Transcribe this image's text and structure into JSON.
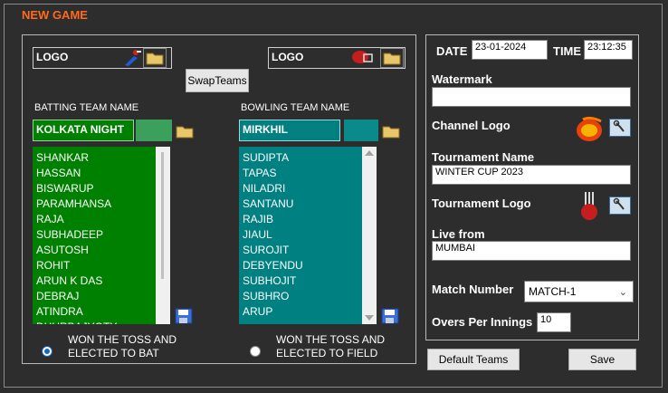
{
  "window": {
    "title": "NEW GAME"
  },
  "batting": {
    "logo_label": "LOGO",
    "team_label": "BATTING TEAM NAME",
    "team_name": "KOLKATA NIGHT",
    "players": [
      "SHANKAR",
      "HASSAN",
      "BISWARUP",
      "PARAMHANSA",
      "RAJA",
      "SUBHADEEP",
      "ASUTOSH",
      "ROHIT",
      "ARUN K DAS",
      "DEBRAJ",
      "ATINDRA",
      "DHURBAJYOTY"
    ],
    "toss_label_1": "WON THE TOSS AND",
    "toss_label_2": "ELECTED TO BAT",
    "color": "#008000"
  },
  "bowling": {
    "logo_label": "LOGO",
    "team_label": "BOWLING TEAM NAME",
    "team_name": "MIRKHIL",
    "players": [
      "SUDIPTA",
      "TAPAS",
      "NILADRI",
      "SANTANU",
      "RAJIB",
      "JIAUL",
      "SUROJIT",
      "DEBYENDU",
      "SUBHOJIT",
      "SUBHRO",
      "ARUP"
    ],
    "toss_label_1": "WON THE TOSS AND",
    "toss_label_2": "ELECTED TO FIELD",
    "color": "#008080"
  },
  "swap_button": "SwapTeams",
  "settings": {
    "date_label": "DATE",
    "date_value": "23-01-2024",
    "time_label": "TIME",
    "time_value": "23:12:35",
    "watermark_label": "Watermark",
    "watermark_value": "",
    "channel_logo_label": "Channel Logo",
    "tournament_name_label": "Tournament Name",
    "tournament_name_value": "WINTER CUP 2023",
    "tournament_logo_label": "Tournament Logo",
    "live_from_label": "Live from",
    "live_from_value": "MUMBAI",
    "match_number_label": "Match Number",
    "match_number_value": "MATCH-1",
    "overs_label": "Overs Per Innings",
    "overs_value": "10"
  },
  "buttons": {
    "default_teams": "Default Teams",
    "save": "Save"
  },
  "icons": [
    "folder-icon",
    "save-icon",
    "wrench-icon",
    "cricket-batter-icon",
    "cricket-helmet-icon",
    "t20-logo-icon",
    "cricket-tournament-logo-icon"
  ]
}
